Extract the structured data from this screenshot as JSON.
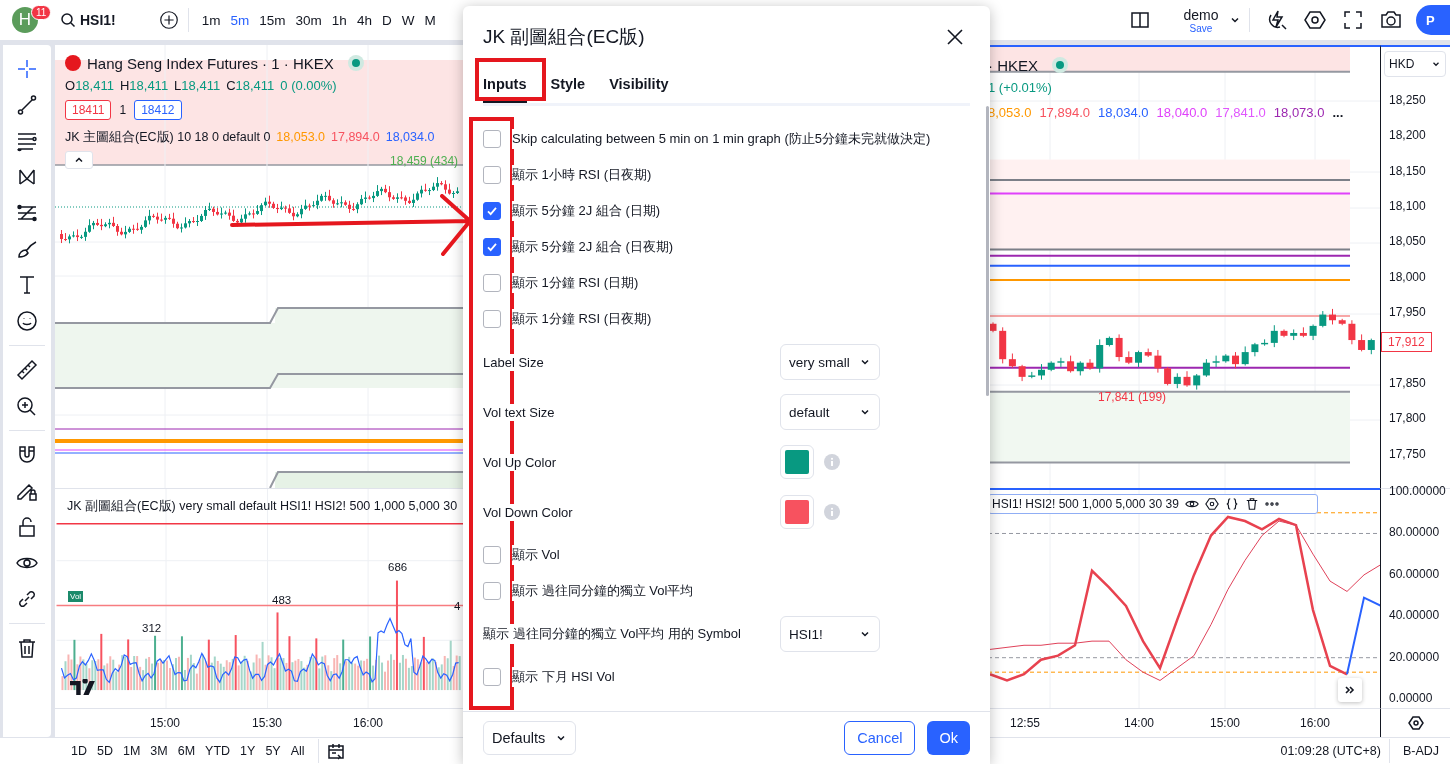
{
  "top_bar": {
    "avatar": "H",
    "notifications": "11",
    "symbol": "HSI1!",
    "intervals": [
      {
        "label": "1m",
        "selected": false
      },
      {
        "label": "5m",
        "selected": true
      },
      {
        "label": "15m",
        "selected": false
      },
      {
        "label": "30m",
        "selected": false
      },
      {
        "label": "1h",
        "selected": false
      },
      {
        "label": "4h",
        "selected": false
      },
      {
        "label": "D",
        "selected": false
      },
      {
        "label": "W",
        "selected": false
      },
      {
        "label": "M",
        "selected": false
      }
    ],
    "layout_name": "demo",
    "save": "Save",
    "publish": "P"
  },
  "left_chart": {
    "title": "Hang Seng Index Futures · 1 · HKEX",
    "ohlc": [
      {
        "label": "O",
        "value": "18,411"
      },
      {
        "label": "H",
        "value": "18,411"
      },
      {
        "label": "L",
        "value": "18,411"
      },
      {
        "label": "C",
        "value": "18,411"
      }
    ],
    "change": "0 (0.00%)",
    "bid": "18411",
    "quantity": "1",
    "ask": "18412",
    "indicator": "JK 主圖組合(EC版) 10 18 0 default 0",
    "indicator_values": [
      {
        "value": "18,053.0",
        "color": "#ff9800"
      },
      {
        "value": "17,894.0",
        "color": "#f7525f"
      },
      {
        "value": "18,034.0",
        "color": "#2962ff"
      }
    ],
    "high_label": "18,459 (434)",
    "sub_indicator": "JK 副圖組合(EC版) very small default HSI1! HSI2! 500 1,000 5,000 30",
    "vol_badge": "Vol",
    "vol_labels": [
      "312",
      "483",
      "686",
      "4"
    ],
    "time_labels": [
      "15:00",
      "15:30",
      "16:00"
    ]
  },
  "right_chart": {
    "title": "· HKEX",
    "change": "1 (+0.01%)",
    "indicator_values": [
      {
        "value": "8,053.0",
        "color": "#ff9800"
      },
      {
        "value": "17,894.0",
        "color": "#f7525f"
      },
      {
        "value": "18,034.0",
        "color": "#2962ff"
      },
      {
        "value": "18,040.0",
        "color": "#e040fb"
      },
      {
        "value": "17,841.0",
        "color": "#e056fd"
      },
      {
        "value": "18,073.0",
        "color": "#9c27b0"
      }
    ],
    "more": "...",
    "low_label": "17,841 (199)",
    "currency": "HKD",
    "last_price": "17,912",
    "price_chart": {
      "chart_data": {
        "type": "candlestick",
        "ylim": [
          17703,
          18326
        ],
        "grid": true,
        "bands": [
          {
            "axis": "y",
            "from": 18291,
            "to": 18326,
            "color": "#fde4e4"
          },
          {
            "axis": "y",
            "from": 18040,
            "to": 18167,
            "color": "#fff1f1"
          },
          {
            "axis": "y",
            "from": 17739,
            "to": 17839,
            "color": "#f1f8f1"
          }
        ],
        "ref_lines": [
          {
            "axis": "y",
            "value": 18291,
            "color": "#9598a1"
          },
          {
            "axis": "y",
            "value": 18138,
            "color": "#7c7f88"
          },
          {
            "axis": "y",
            "value": 18119,
            "color": "#e040fb"
          },
          {
            "axis": "y",
            "value": 18040,
            "color": "#7c7f88"
          },
          {
            "axis": "y",
            "value": 18031,
            "color": "#9c27b0"
          },
          {
            "axis": "y",
            "value": 18017,
            "color": "#2962ff"
          },
          {
            "axis": "y",
            "value": 17997,
            "color": "#ff9800"
          },
          {
            "axis": "y",
            "value": 17946,
            "color": "#f7a6a6"
          },
          {
            "axis": "y",
            "value": 17873,
            "color": "#9c27b0"
          },
          {
            "axis": "y",
            "value": 17839,
            "color": "#9598a1"
          },
          {
            "axis": "y",
            "value": 17739,
            "color": "#9598a1"
          }
        ],
        "ohlc": [
          [
            17935,
            17937,
            17923,
            17925
          ],
          [
            17925,
            17930,
            17879,
            17885
          ],
          [
            17885,
            17893,
            17873,
            17875
          ],
          [
            17875,
            17877,
            17854,
            17860
          ],
          [
            17860,
            17867,
            17858,
            17862
          ],
          [
            17862,
            17878,
            17856,
            17870
          ],
          [
            17870,
            17882,
            17868,
            17880
          ],
          [
            17880,
            17887,
            17874,
            17882
          ],
          [
            17882,
            17890,
            17866,
            17868
          ],
          [
            17868,
            17882,
            17862,
            17880
          ],
          [
            17880,
            17885,
            17870,
            17872
          ],
          [
            17872,
            17913,
            17866,
            17905
          ],
          [
            17905,
            17917,
            17903,
            17915
          ],
          [
            17915,
            17920,
            17882,
            17888
          ],
          [
            17888,
            17896,
            17878,
            17880
          ],
          [
            17880,
            17897,
            17874,
            17895
          ],
          [
            17895,
            17900,
            17888,
            17890
          ],
          [
            17890,
            17898,
            17866,
            17872
          ],
          [
            17872,
            17874,
            17848,
            17850
          ],
          [
            17850,
            17865,
            17844,
            17860
          ],
          [
            17860,
            17868,
            17846,
            17848
          ],
          [
            17848,
            17864,
            17842,
            17862
          ],
          [
            17862,
            17885,
            17860,
            17880
          ],
          [
            17880,
            17890,
            17874,
            17882
          ],
          [
            17882,
            17892,
            17880,
            17890
          ],
          [
            17890,
            17895,
            17872,
            17878
          ],
          [
            17878,
            17903,
            17876,
            17895
          ],
          [
            17895,
            17908,
            17889,
            17906
          ],
          [
            17906,
            17913,
            17904,
            17908
          ],
          [
            17908,
            17933,
            17902,
            17925
          ],
          [
            17925,
            17927,
            17916,
            17918
          ],
          [
            17918,
            17927,
            17912,
            17922
          ],
          [
            17922,
            17930,
            17916,
            17918
          ],
          [
            17918,
            17934,
            17912,
            17932
          ],
          [
            17932,
            17953,
            17930,
            17948
          ],
          [
            17948,
            17956,
            17934,
            17940
          ],
          [
            17940,
            17942,
            17933,
            17935
          ],
          [
            17935,
            17940,
            17906,
            17912
          ],
          [
            17912,
            17920,
            17896,
            17898
          ],
          [
            17898,
            17914,
            17892,
            17912
          ]
        ],
        "yticks": [
          {
            "value": 18250,
            "label": "18,250"
          },
          {
            "value": 18200,
            "label": "18,200"
          },
          {
            "value": 18150,
            "label": "18,150"
          },
          {
            "value": 18100,
            "label": "18,100"
          },
          {
            "value": 18050,
            "label": "18,050"
          },
          {
            "value": 18000,
            "label": "18,000"
          },
          {
            "value": 17950,
            "label": "17,950"
          },
          {
            "value": 17850,
            "label": "17,850"
          },
          {
            "value": 17800,
            "label": "17,800"
          },
          {
            "value": 17750,
            "label": "17,750"
          }
        ]
      }
    },
    "sub_indicator": "HSI1! HSI2! 500 1,000 5,000 30 39",
    "oscillator": {
      "chart_data": {
        "type": "line",
        "ylim": [
          -4.3,
          101
        ],
        "grid": true,
        "ref_lines": [
          {
            "axis": "y",
            "value": 90,
            "color": "#ff9800"
          },
          {
            "axis": "y",
            "value": 80,
            "color": "#9598a1"
          },
          {
            "axis": "y",
            "value": 20,
            "color": "#9598a1"
          },
          {
            "axis": "y",
            "value": 13,
            "color": "#ff9800"
          }
        ],
        "yticks": [
          {
            "value": 100,
            "label": "100.00000"
          },
          {
            "value": 80,
            "label": "80.00000"
          },
          {
            "value": 60,
            "label": "60.00000"
          },
          {
            "value": 40,
            "label": "40.00000"
          },
          {
            "value": 20,
            "label": "20.00000"
          },
          {
            "value": 0,
            "label": "0.00000"
          }
        ],
        "series": [
          {
            "color": "#e8424f",
            "values": [
              12,
              9,
              12,
              19,
              21,
              26,
              62,
              54,
              45,
              28,
              15,
              38,
              60,
              79,
              88,
              86,
              82,
              87,
              84,
              43,
              16,
              12,
              null,
              null
            ]
          },
          {
            "color": "#e0425a",
            "values": [
              24,
              25,
              26,
              26,
              27,
              27,
              28,
              28,
              19,
              13,
              9,
              15,
              21,
              36,
              53,
              67,
              79,
              86,
              84,
              70,
              57,
              52,
              60,
              65
            ]
          },
          {
            "color": "#2962ff",
            "values": [
              null,
              null,
              null,
              null,
              null,
              null,
              null,
              null,
              null,
              null,
              null,
              null,
              null,
              null,
              null,
              null,
              null,
              null,
              null,
              null,
              null,
              12,
              49,
              45
            ]
          }
        ]
      }
    },
    "time_labels": [
      "12:55",
      "14:00",
      "15:00",
      "16:00"
    ]
  },
  "bottom_bar": {
    "ranges": [
      "1D",
      "5D",
      "1M",
      "3M",
      "6M",
      "YTD",
      "1Y",
      "5Y",
      "All"
    ],
    "clock": "01:09:28 (UTC+8)",
    "adjustment": "B-ADJ"
  },
  "dialog": {
    "title": "JK 副圖組合(EC版)",
    "tabs": [
      {
        "label": "Inputs",
        "selected": true
      },
      {
        "label": "Style",
        "selected": false
      },
      {
        "label": "Visibility",
        "selected": false
      }
    ],
    "inputs": [
      {
        "kind": "checkbox",
        "label": "Skip calculating between 5 min on 1 min graph (防止5分鐘未完就做決定)",
        "checked": false
      },
      {
        "kind": "checkbox",
        "label": "顯示 1小時 RSI (日夜期)",
        "checked": false
      },
      {
        "kind": "checkbox",
        "label": "顯示 5分鐘 2J 組合 (日期)",
        "checked": true
      },
      {
        "kind": "checkbox",
        "label": "顯示 5分鐘 2J 組合 (日夜期)",
        "checked": true
      },
      {
        "kind": "checkbox",
        "label": "顯示 1分鐘 RSI (日期)",
        "checked": false
      },
      {
        "kind": "checkbox",
        "label": "顯示 1分鐘 RSI (日夜期)",
        "checked": false
      },
      {
        "kind": "select",
        "label": "Label Size",
        "value": "very small"
      },
      {
        "kind": "select",
        "label": "Vol text Size",
        "value": "default"
      },
      {
        "kind": "color",
        "label": "Vol Up Color",
        "color": "#089981"
      },
      {
        "kind": "color",
        "label": "Vol Down Color",
        "color": "#f7525f"
      },
      {
        "kind": "checkbox",
        "label": "顯示 Vol",
        "checked": false
      },
      {
        "kind": "checkbox",
        "label": "顯示 過往同分鐘的獨立 Vol平均",
        "checked": false
      },
      {
        "kind": "select",
        "label": "顯示 過往同分鐘的獨立 Vol平均 用的 Symbol",
        "value": "HSI1!"
      },
      {
        "kind": "checkbox",
        "label": "顯示 下月 HSI Vol",
        "checked": false
      }
    ],
    "buttons": {
      "defaults": "Defaults",
      "cancel": "Cancel",
      "ok": "Ok"
    }
  }
}
